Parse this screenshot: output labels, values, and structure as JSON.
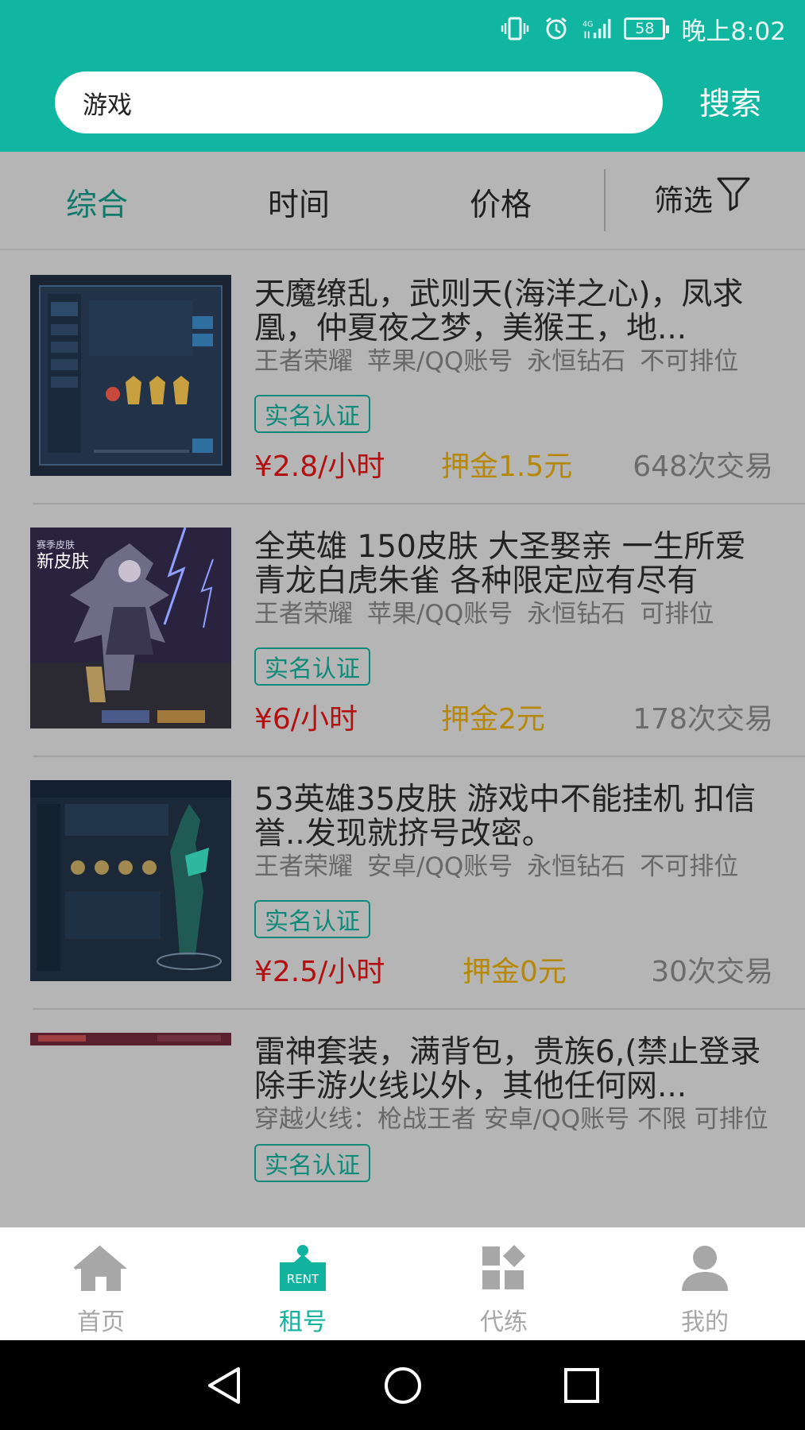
{
  "status_bar": {
    "battery": "58",
    "time": "晚上8:02"
  },
  "search": {
    "value": "游戏",
    "button_label": "搜索"
  },
  "filters": {
    "tabs": [
      "综合",
      "时间",
      "价格"
    ],
    "active": "综合",
    "filter_label": "筛选"
  },
  "listings": [
    {
      "title": "天魔缭乱，武则天(海洋之心)，凤求凰，仲夏夜之梦，美猴王，地...",
      "game": "王者荣耀",
      "account": "苹果/QQ账号",
      "rank": "永恒钻石",
      "ranked": "不可排位",
      "badge": "实名认证",
      "price": "¥2.8/小时",
      "deposit": "押金1.5元",
      "trades": "648次交易"
    },
    {
      "title": "全英雄 150皮肤 大圣娶亲 一生所爱 青龙白虎朱雀 各种限定应有尽有",
      "game": "王者荣耀",
      "account": "苹果/QQ账号",
      "rank": "永恒钻石",
      "ranked": "可排位",
      "badge": "实名认证",
      "price": "¥6/小时",
      "deposit": "押金2元",
      "trades": "178次交易"
    },
    {
      "title": "53英雄35皮肤 游戏中不能挂机 扣信誉..发现就挤号改密。",
      "game": "王者荣耀",
      "account": "安卓/QQ账号",
      "rank": "永恒钻石",
      "ranked": "不可排位",
      "badge": "实名认证",
      "price": "¥2.5/小时",
      "deposit": "押金0元",
      "trades": "30次交易"
    },
    {
      "title": "雷神套装，满背包，贵族6,(禁止登录除手游火线以外，其他任何网...",
      "meta_line": "穿越火线：枪战王者  安卓/QQ账号  不限  可排位",
      "badge": "实名认证"
    }
  ],
  "thumb_text": {
    "t2_caption": "新皮肤",
    "t2_header": "赛季皮肤"
  },
  "bottom_nav": [
    {
      "label": "首页",
      "icon": "home-icon"
    },
    {
      "label": "租号",
      "icon": "rent-icon",
      "icon_text": "RENT"
    },
    {
      "label": "代练",
      "icon": "boost-icon"
    },
    {
      "label": "我的",
      "icon": "user-icon"
    }
  ],
  "colors": {
    "brand": "#11b6a1",
    "price": "#b31111",
    "deposit": "#b68806",
    "badge": "#0e8a7a"
  }
}
